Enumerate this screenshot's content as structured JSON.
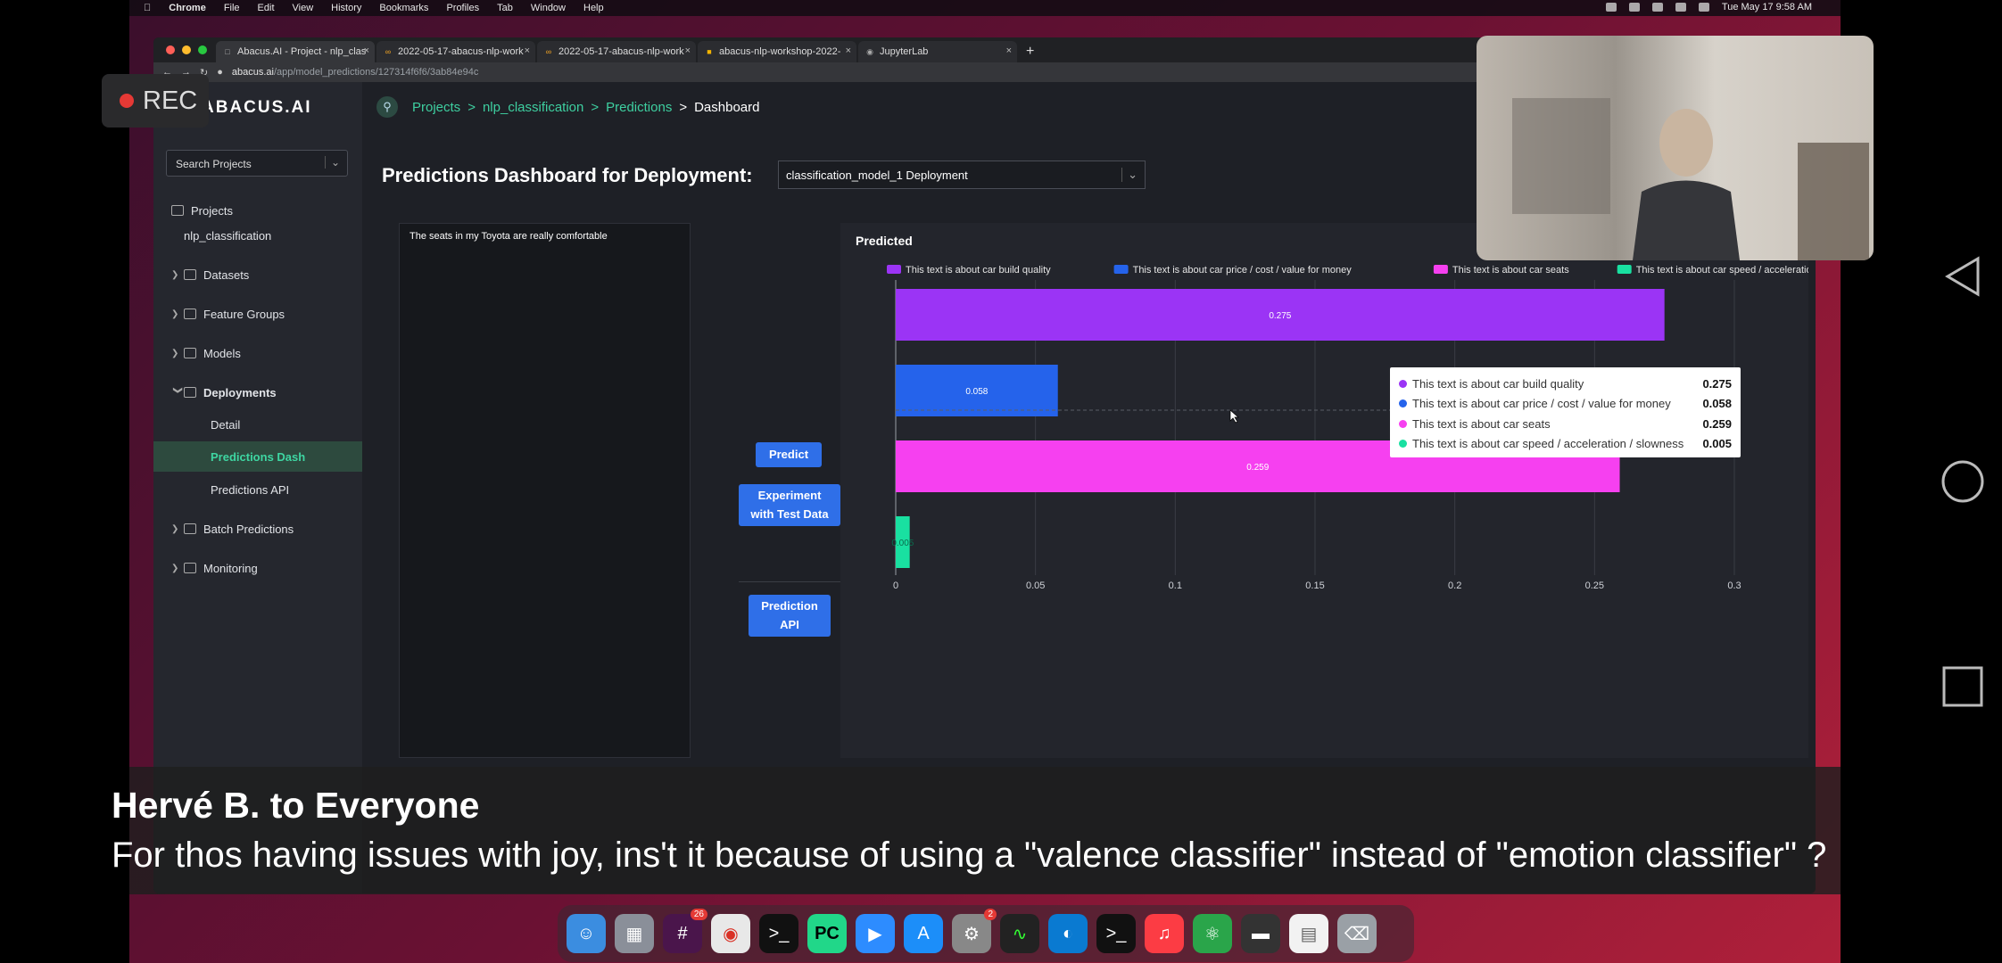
{
  "menubar": {
    "app": "Chrome",
    "items": [
      "File",
      "Edit",
      "View",
      "History",
      "Bookmarks",
      "Profiles",
      "Tab",
      "Window",
      "Help"
    ],
    "clock": "Tue May 17  9:58 AM"
  },
  "browser": {
    "tabs": [
      {
        "label": "Abacus.AI - Project - nlp_clas",
        "icon": "abacus-icon"
      },
      {
        "label": "2022-05-17-abacus-nlp-work",
        "icon": "colab-icon"
      },
      {
        "label": "2022-05-17-abacus-nlp-work",
        "icon": "colab-icon"
      },
      {
        "label": "abacus-nlp-workshop-2022-",
        "icon": "slides-icon"
      },
      {
        "label": "JupyterLab",
        "icon": "globe-icon"
      }
    ],
    "url_host": "abacus.ai",
    "url_path": "/app/model_predictions/127314f6f6/3ab84e94c"
  },
  "recording": {
    "label": "REC"
  },
  "app": {
    "logo": "ABACUS.AI",
    "search_placeholder": "Search Projects",
    "sidebar": {
      "projects": "Projects",
      "project_name": "nlp_classification",
      "datasets": "Datasets",
      "feature_groups": "Feature Groups",
      "models": "Models",
      "deployments": "Deployments",
      "detail": "Detail",
      "predictions_dash": "Predictions Dash",
      "predictions_api": "Predictions API",
      "batch_predictions": "Batch Predictions",
      "monitoring": "Monitoring"
    },
    "breadcrumb": {
      "projects": "Projects",
      "project": "nlp_classification",
      "predictions": "Predictions",
      "current": "Dashboard",
      "sep": ">"
    },
    "page_title": "Predictions Dashboard for Deployment:",
    "deployment_select": "classification_model_1 Deployment",
    "input_text": "The seats in my Toyota are really comfortable",
    "buttons": {
      "predict": "Predict",
      "experiment_line1": "Experiment",
      "experiment_line2": "with Test Data",
      "api_line1": "Prediction",
      "api_line2": "API"
    },
    "chart_title": "Predicted"
  },
  "chart_data": {
    "type": "bar",
    "orientation": "horizontal",
    "title": "Predicted",
    "series": [
      {
        "name": "This text is about car build quality",
        "value": 0.275,
        "color": "#9b34f5"
      },
      {
        "name": "This text is about car price / cost / value for money",
        "value": 0.058,
        "color": "#2563eb"
      },
      {
        "name": "This text is about car seats",
        "value": 0.259,
        "color": "#f640f0"
      },
      {
        "name": "This text is about car speed / acceleration / slowness",
        "value": 0.005,
        "color": "#19e0a1"
      }
    ],
    "x_ticks": [
      "0",
      "0.05",
      "0.1",
      "0.15",
      "0.2",
      "0.25",
      "0.3"
    ],
    "xlim": [
      0,
      0.3
    ],
    "legend": "top",
    "grid": true
  },
  "tooltip": {
    "rows": [
      {
        "label": "This text is about car build quality",
        "value": "0.275",
        "color": "#9b34f5"
      },
      {
        "label": "This text is about car price / cost / value for money",
        "value": "0.058",
        "color": "#2563eb"
      },
      {
        "label": "This text is about car seats",
        "value": "0.259",
        "color": "#f640f0"
      },
      {
        "label": "This text is about car speed / acceleration / slowness",
        "value": "0.005",
        "color": "#19e0a1"
      }
    ]
  },
  "caption": {
    "name": "Hervé B. to Everyone",
    "text": "For thos having issues with joy, ins't it because of using a \"valence classifier\" instead of \"emotion classifier\" ?"
  },
  "dock": {
    "icons": [
      "finder-icon",
      "launchpad-icon",
      "slack-icon",
      "chrome-icon",
      "terminal-icon",
      "pycharm-icon",
      "zoom-icon",
      "appstore-icon",
      "settings-icon",
      "activity-monitor-icon",
      "edge-icon",
      "terminal2-icon",
      "music-icon",
      "atom-icon",
      "drive-icon",
      "document-icon",
      "trash-icon"
    ],
    "slack_badge": "26",
    "settings_badge": "2"
  }
}
